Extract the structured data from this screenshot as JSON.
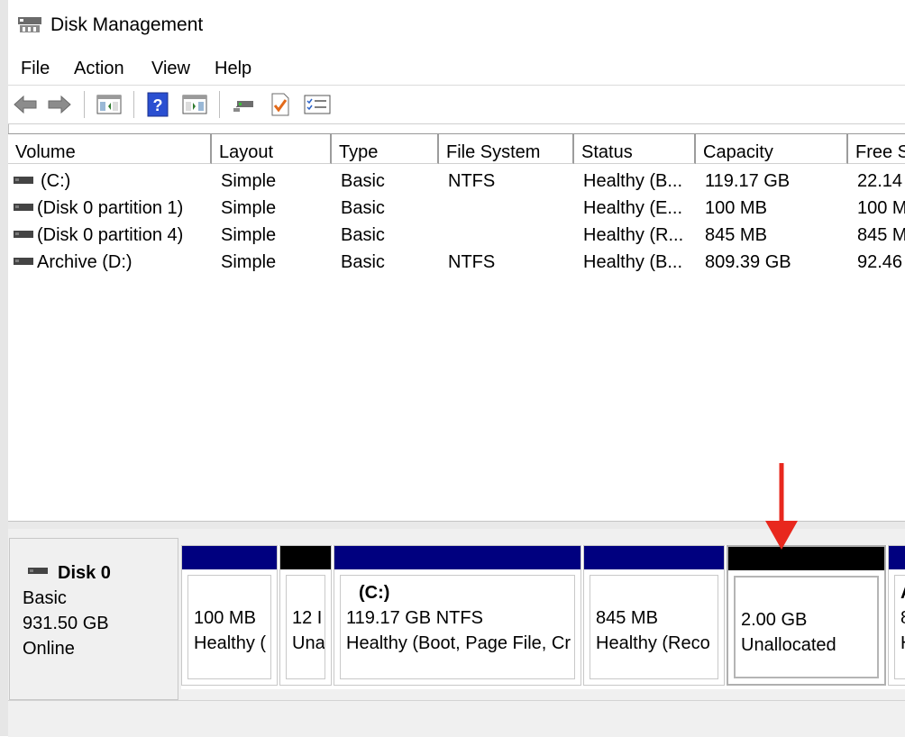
{
  "window": {
    "title": "Disk Management"
  },
  "menu": [
    "File",
    "Action",
    "View",
    "Help"
  ],
  "toolbar": {
    "buttons": [
      "back-icon",
      "forward-icon",
      "console-tree-icon",
      "help-icon",
      "action-pane-icon",
      "connect-icon",
      "checklist-icon",
      "properties-icon"
    ]
  },
  "volume_list": {
    "headers": [
      "Volume",
      "Layout",
      "Type",
      "File System",
      "Status",
      "Capacity",
      "Free S"
    ],
    "rows": [
      {
        "volume": "(C:)",
        "layout": "Simple",
        "type": "Basic",
        "fs": "NTFS",
        "status": "Healthy (B...",
        "capacity": "119.17 GB",
        "free": "22.14"
      },
      {
        "volume": "(Disk 0 partition 1)",
        "layout": "Simple",
        "type": "Basic",
        "fs": "",
        "status": "Healthy (E...",
        "capacity": "100 MB",
        "free": "100 M"
      },
      {
        "volume": "(Disk 0 partition 4)",
        "layout": "Simple",
        "type": "Basic",
        "fs": "",
        "status": "Healthy (R...",
        "capacity": "845 MB",
        "free": "845 M"
      },
      {
        "volume": "Archive (D:)",
        "layout": "Simple",
        "type": "Basic",
        "fs": "NTFS",
        "status": "Healthy (B...",
        "capacity": "809.39 GB",
        "free": "92.46"
      }
    ]
  },
  "disk": {
    "name": "Disk 0",
    "type": "Basic",
    "size": "931.50 GB",
    "state": "Online"
  },
  "partitions": [
    {
      "title": "",
      "line1": "100 MB",
      "line2": "Healthy (",
      "bar_color": "#00007f",
      "unallocated": false
    },
    {
      "title": "",
      "line1": "12 I",
      "line2": "Una",
      "bar_color": "#000000",
      "unallocated": false
    },
    {
      "title": "(C:)",
      "line1": "119.17 GB NTFS",
      "line2": "Healthy (Boot, Page File, Cr",
      "bar_color": "#00007f",
      "unallocated": false
    },
    {
      "title": "",
      "line1": "845 MB",
      "line2": "Healthy (Reco",
      "bar_color": "#00007f",
      "unallocated": false
    },
    {
      "title": "",
      "line1": "2.00 GB",
      "line2": "Unallocated",
      "bar_color": "#000000",
      "unallocated": true
    },
    {
      "title": "A",
      "line1": "8",
      "line2": "H",
      "bar_color": "#00007f",
      "unallocated": false
    }
  ],
  "annotation": {
    "arrow_color": "#e8281e"
  }
}
